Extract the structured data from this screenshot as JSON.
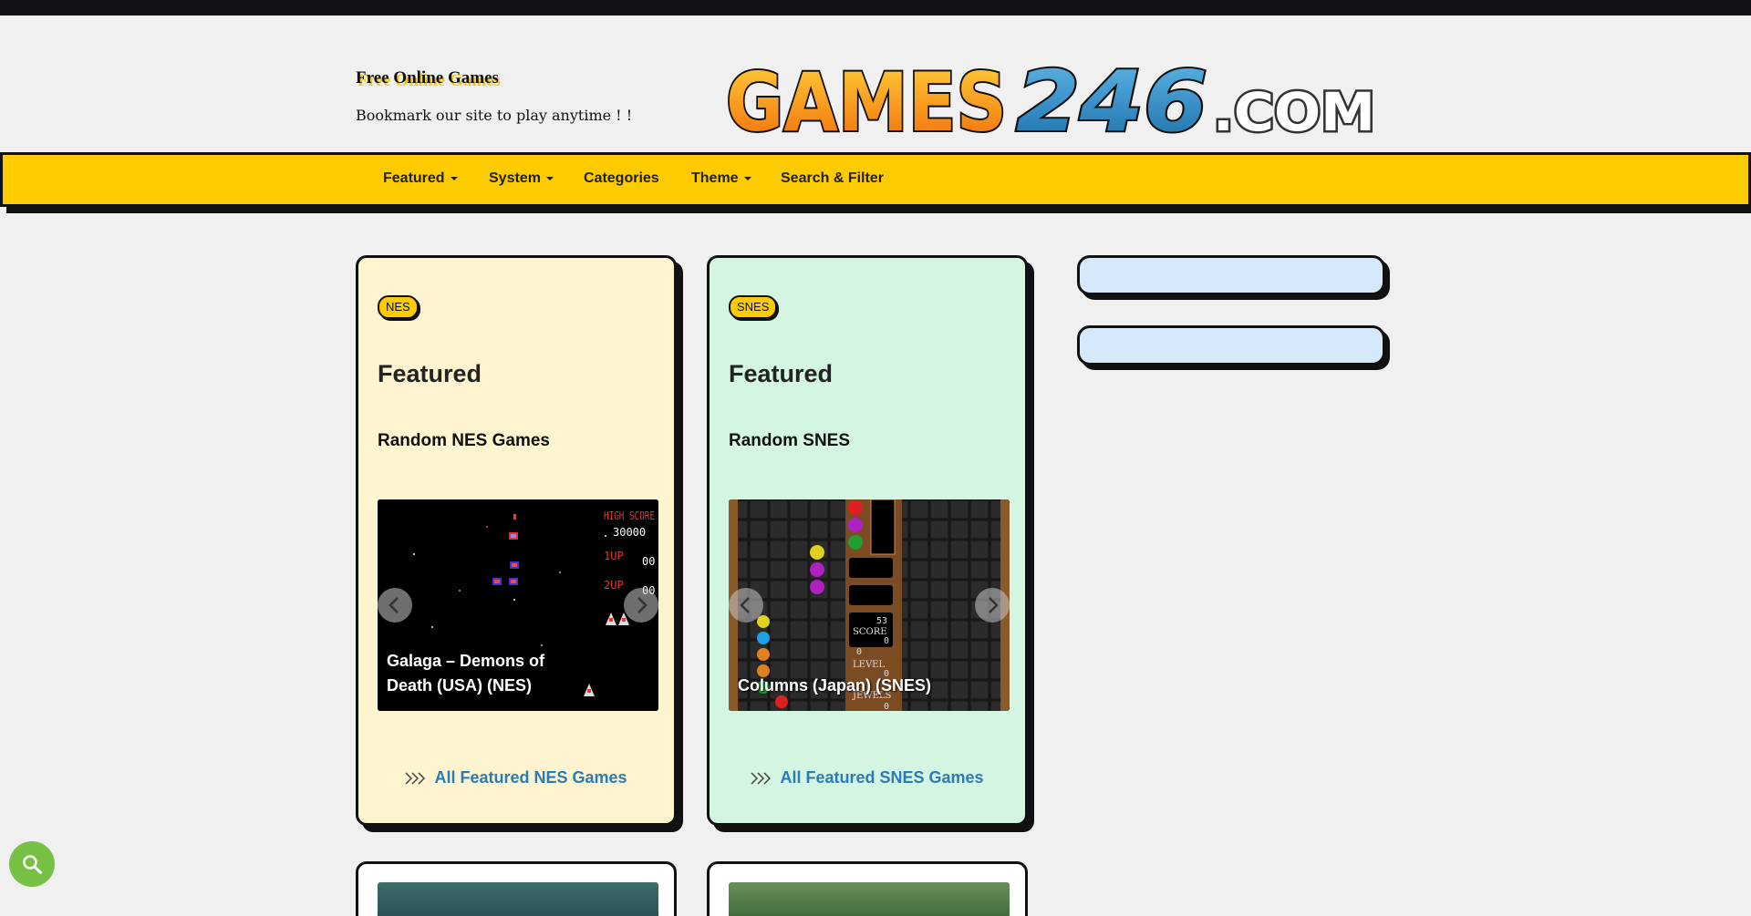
{
  "site": {
    "title": "Free Online Games",
    "tagline": "Bookmark our site to play anytime ! !",
    "logo_text": {
      "games": "GAMES",
      "number": "246",
      "tld": ".COM"
    }
  },
  "nav": {
    "items": [
      {
        "label": "Featured",
        "dropdown": true
      },
      {
        "label": "System",
        "dropdown": true
      },
      {
        "label": "Categories",
        "dropdown": false
      },
      {
        "label": "Theme",
        "dropdown": true
      },
      {
        "label": "Search & Filter",
        "dropdown": false
      }
    ]
  },
  "cards": [
    {
      "badge": "NES",
      "title": "Featured",
      "subtitle": "Random NES Games",
      "slide_caption": "Galaga – Demons of Death (USA) (NES)",
      "link": "All Featured NES Games"
    },
    {
      "badge": "SNES",
      "title": "Featured",
      "subtitle": "Random SNES",
      "slide_caption": "Columns (Japan) (SNES)",
      "link": "All Featured SNES Games"
    }
  ],
  "game_screens": {
    "galaga": {
      "high_score_label": "HIGH SCORE",
      "high_score": "30000",
      "p1": "1UP",
      "p2": "2UP",
      "p1_score": "00",
      "p2_score": "00"
    },
    "columns": {
      "score_value": "53",
      "score_label": "SCORE",
      "score": "0",
      "level_value": "0",
      "level_label": "LEVEL",
      "level": "0",
      "jewels_label": "JEWELS",
      "jewels": "0"
    }
  },
  "icons": {
    "dropdown": "caret-down-icon",
    "slider_prev": "chevron-left-icon",
    "slider_next": "chevron-right-icon",
    "link_arrows": "triple-chevron-right-icon",
    "search": "search-icon"
  },
  "colors": {
    "topbar": "#121317",
    "nav_bg": "#fecb00",
    "nes_card": "#fef4cf",
    "snes_card": "#d3f5e2",
    "link": "#2c7bb6",
    "sidebar_box": "#d6e9fb",
    "search_fab": "#76c043"
  }
}
